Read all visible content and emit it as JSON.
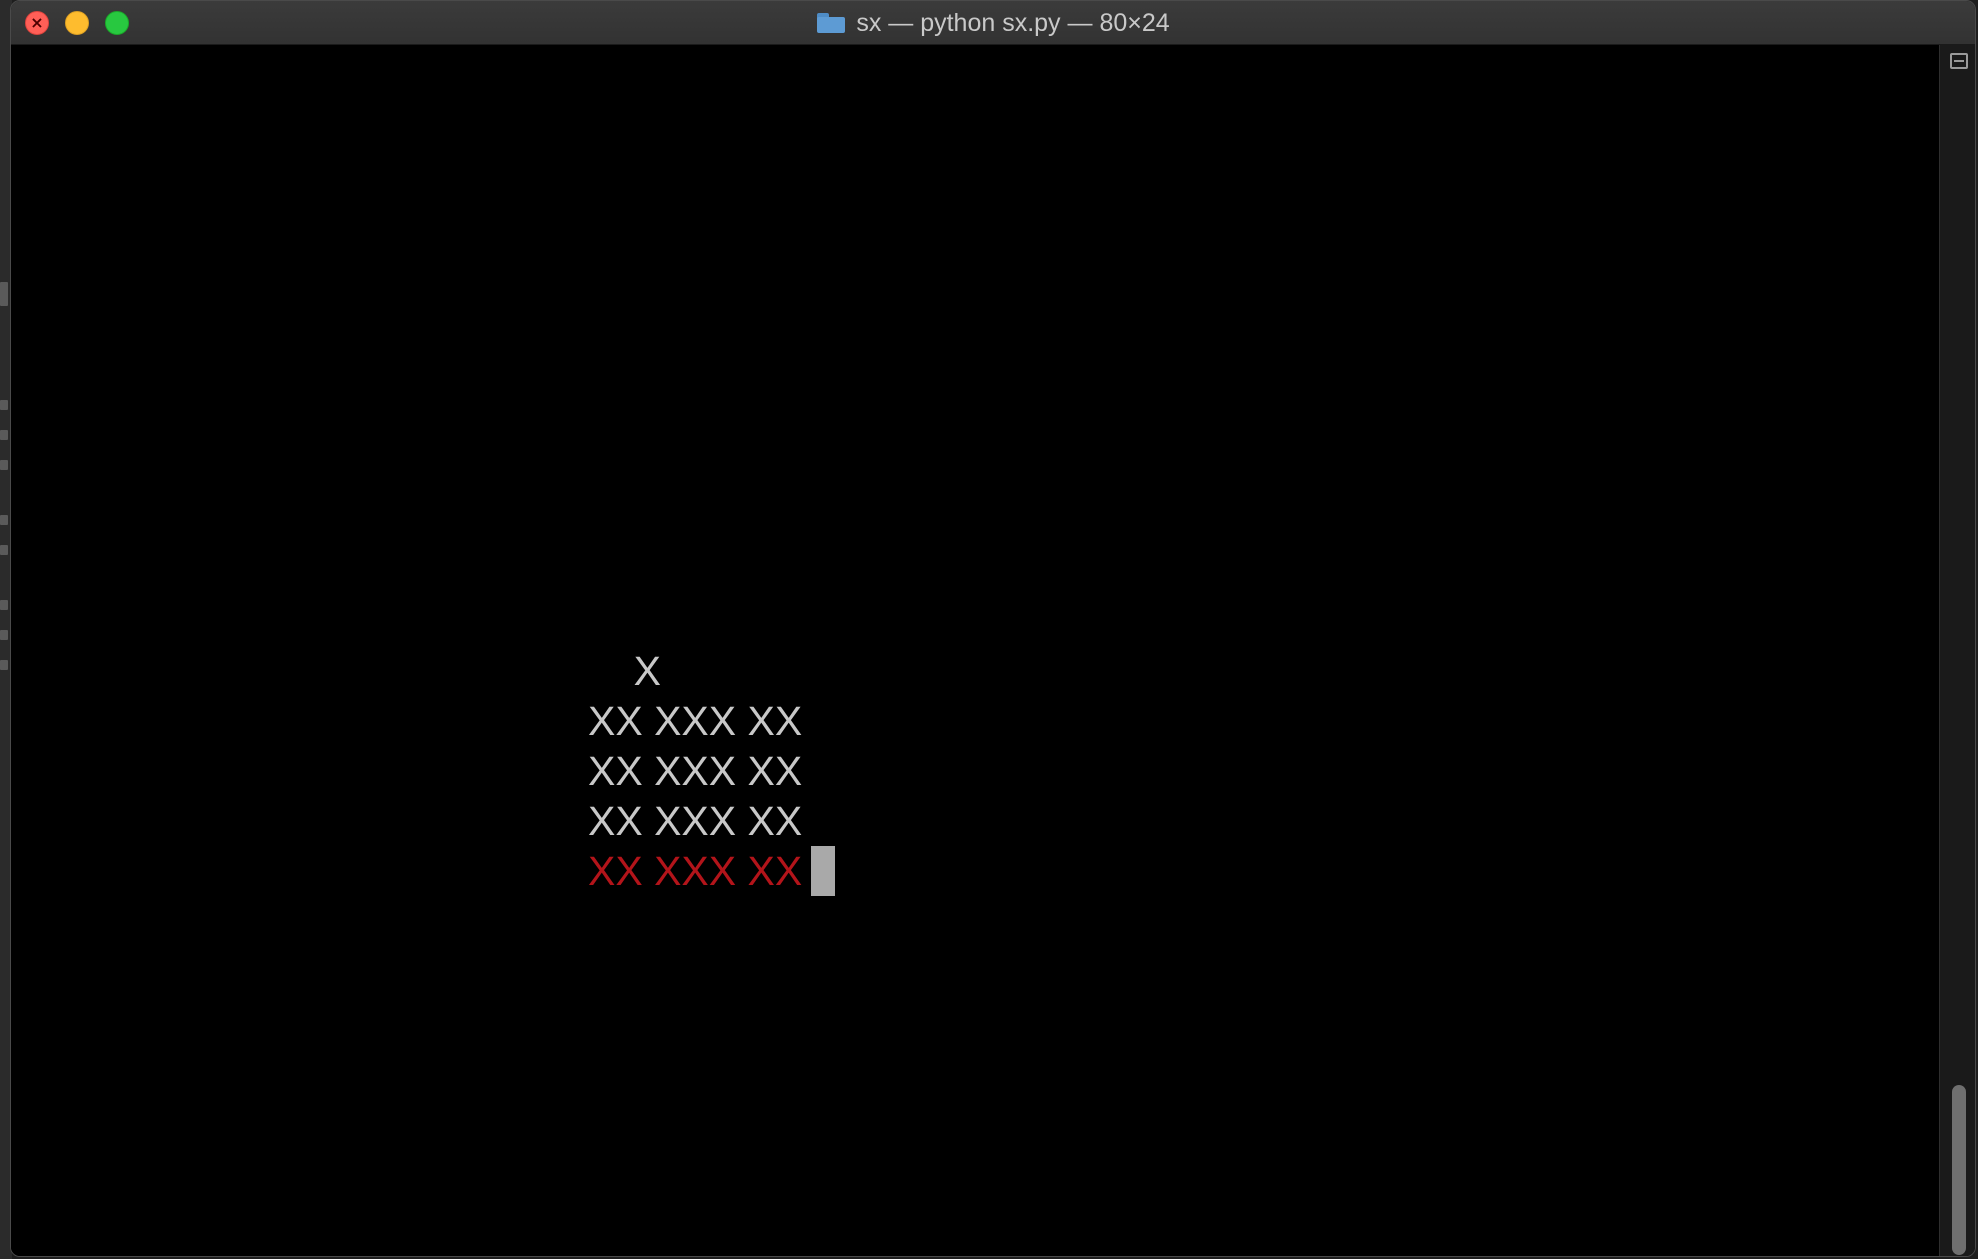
{
  "window": {
    "title": "sx — python sx.py — 80×24"
  },
  "terminal": {
    "lines": [
      "    X",
      "XX XXX XX",
      "XX XXX XX",
      "XX XXX XX",
      "XX XXX XX"
    ],
    "red_line_color": "#b3141a",
    "text_color": "#c8c8c8",
    "cursor_color": "#a9a9a9"
  },
  "icons": {
    "folder": "folder-icon",
    "split": "split-pane-icon",
    "close": "close-icon"
  }
}
